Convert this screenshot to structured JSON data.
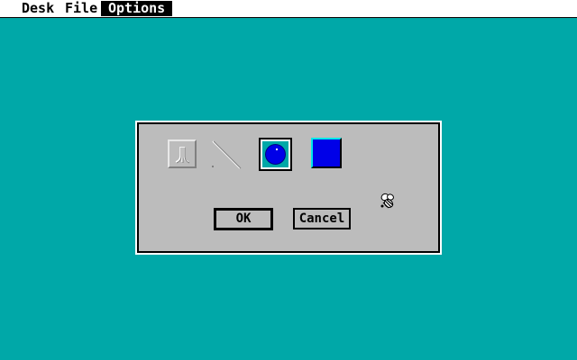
{
  "menubar": {
    "items": [
      {
        "label": "Desk",
        "active": false
      },
      {
        "label": "File",
        "active": false
      },
      {
        "label": "Options",
        "active": true
      }
    ]
  },
  "dialog": {
    "tools": [
      {
        "name": "atari-logo",
        "selected": false
      },
      {
        "name": "line",
        "selected": false
      },
      {
        "name": "ball",
        "selected": true
      },
      {
        "name": "square",
        "selected": false
      }
    ],
    "buttons": {
      "ok_label": "OK",
      "cancel_label": "Cancel"
    }
  },
  "cursor": {
    "icon": "busy-bee-icon"
  },
  "colors": {
    "desktop": "#00a8a8",
    "dialog": "#bcbcbc",
    "ball": "#0000e8",
    "square": "#0000e8",
    "square_highlight": "#00e8e8",
    "menu_highlight": "#000000"
  }
}
